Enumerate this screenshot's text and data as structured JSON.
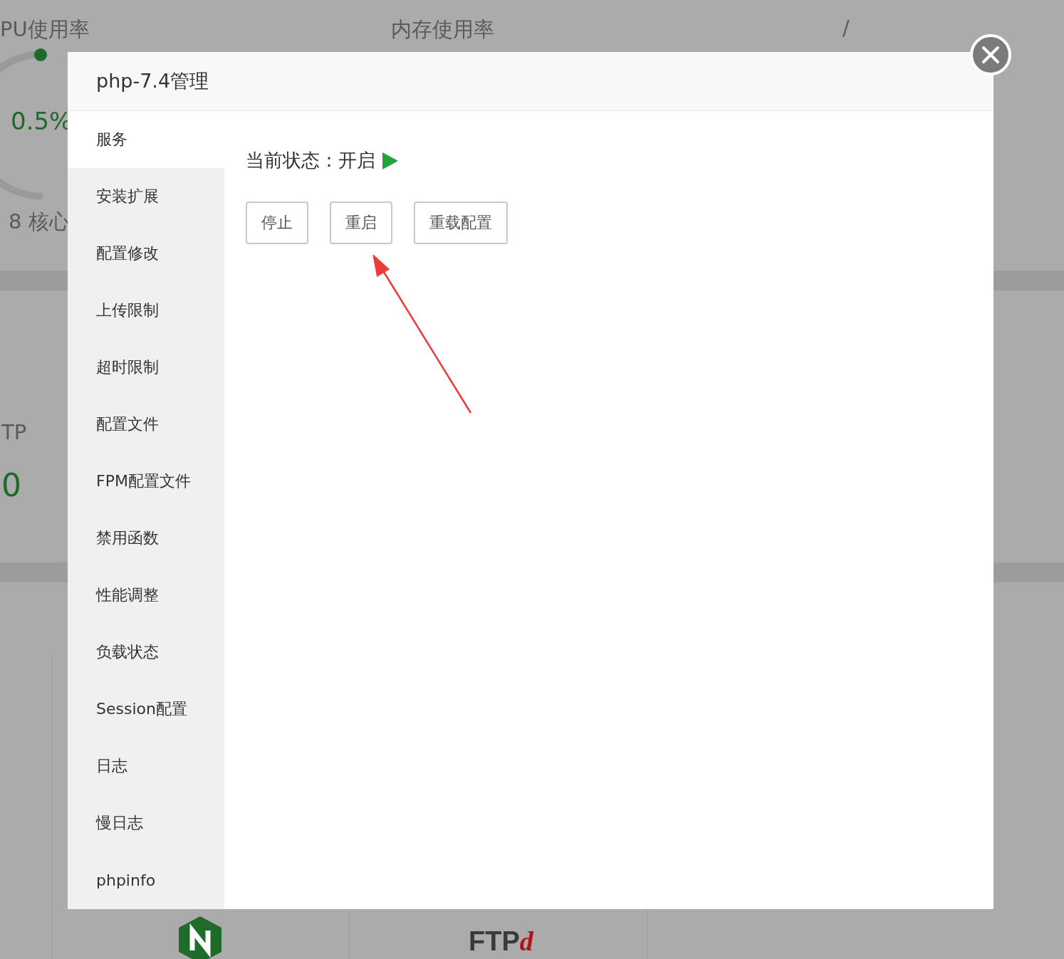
{
  "background": {
    "cpu": {
      "title": "PU使用率",
      "value": "0.5%",
      "cores": "8 核心"
    },
    "memory": {
      "title": "内存使用率"
    },
    "disk": {
      "title": "/"
    },
    "ftp": {
      "label": "TP",
      "value": "0"
    },
    "ftp_logo": {
      "text": "FTP",
      "accent": "d"
    }
  },
  "dialog": {
    "title": "php-7.4管理",
    "menu": [
      {
        "label": "服务",
        "selected": true
      },
      {
        "label": "安装扩展",
        "selected": false
      },
      {
        "label": "配置修改",
        "selected": false
      },
      {
        "label": "上传限制",
        "selected": false
      },
      {
        "label": "超时限制",
        "selected": false
      },
      {
        "label": "配置文件",
        "selected": false
      },
      {
        "label": "FPM配置文件",
        "selected": false
      },
      {
        "label": "禁用函数",
        "selected": false
      },
      {
        "label": "性能调整",
        "selected": false
      },
      {
        "label": "负载状态",
        "selected": false
      },
      {
        "label": "Session配置",
        "selected": false
      },
      {
        "label": "日志",
        "selected": false
      },
      {
        "label": "慢日志",
        "selected": false
      },
      {
        "label": "phpinfo",
        "selected": false
      }
    ],
    "status": {
      "label": "当前状态：",
      "value": "开启",
      "running": true
    },
    "buttons": [
      "停止",
      "重启",
      "重载配置"
    ]
  }
}
